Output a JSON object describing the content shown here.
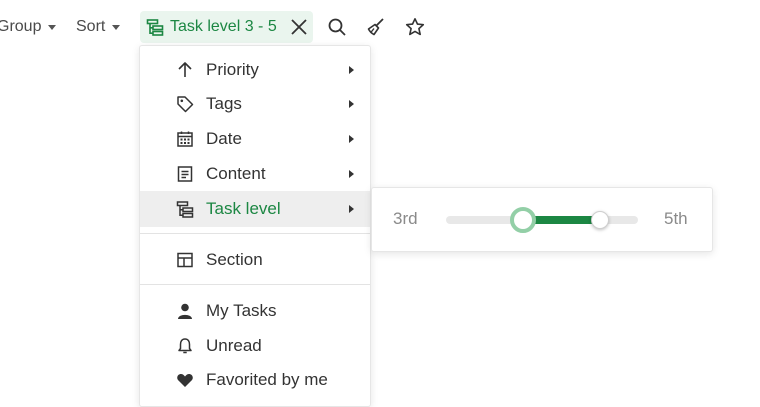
{
  "toolbar": {
    "group_label": "Group",
    "sort_label": "Sort",
    "filter_chip_label": "Task level 3 - 5",
    "accent_color": "#1c8743"
  },
  "menu": {
    "items": [
      {
        "label": "Priority",
        "icon": "arrow-up-icon",
        "has_submenu": true
      },
      {
        "label": "Tags",
        "icon": "tag-icon",
        "has_submenu": true
      },
      {
        "label": "Date",
        "icon": "calendar-icon",
        "has_submenu": true
      },
      {
        "label": "Content",
        "icon": "document-icon",
        "has_submenu": true
      },
      {
        "label": "Task level",
        "icon": "hierarchy-icon",
        "has_submenu": true,
        "active": true
      },
      {
        "label": "Section",
        "icon": "section-layout-icon",
        "has_submenu": false
      },
      {
        "label": "My Tasks",
        "icon": "person-icon",
        "has_submenu": false
      },
      {
        "label": "Unread",
        "icon": "bell-icon",
        "has_submenu": false
      },
      {
        "label": "Favorited by me",
        "icon": "heart-icon",
        "has_submenu": false
      }
    ]
  },
  "task_level_range": {
    "min_label": "3rd",
    "max_label": "5th",
    "low_value": 0.4,
    "high_value": 0.8
  }
}
